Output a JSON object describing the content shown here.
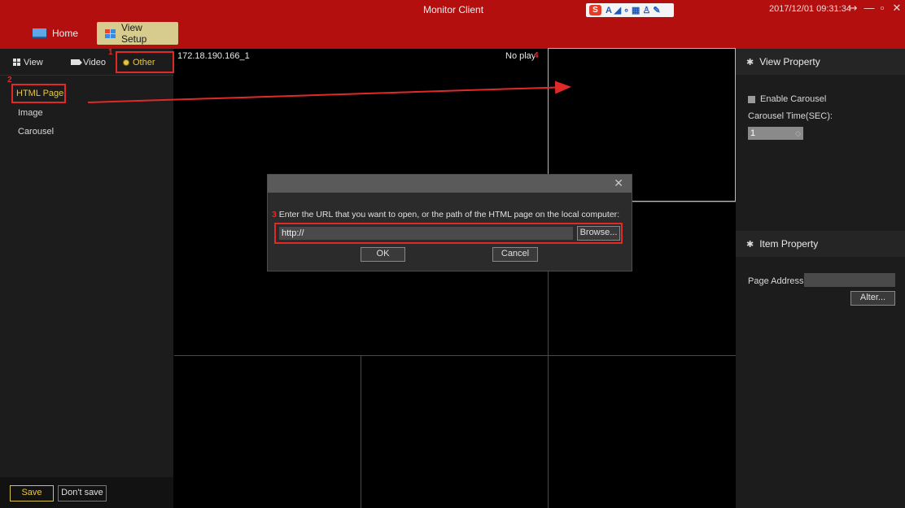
{
  "titlebar": {
    "app_title": "Monitor Client",
    "datetime": "2017/12/01 09:31:34",
    "ime_text": "A ◢ ∘ ▦ ♙ ✎",
    "window_controls": [
      "↪",
      "—",
      "▫",
      "✕"
    ]
  },
  "top_tabs": {
    "home": "Home",
    "view_setup": "View Setup"
  },
  "left_tabs": {
    "view": "View",
    "video": "Video",
    "other": "Other"
  },
  "left_items": {
    "html_page": "HTML Page",
    "image": "Image",
    "carousel": "Carousel"
  },
  "step_markers": [
    "1",
    "2",
    "3",
    "4"
  ],
  "left_buttons": {
    "save": "Save",
    "dont_save": "Don't save"
  },
  "video": {
    "channel_label": "172.18.190.166_1",
    "status": "No play"
  },
  "dialog": {
    "close": "✕",
    "prompt": "Enter the URL that you want to open, or the path of the HTML page on the local computer:",
    "url_value": "http://",
    "browse": "Browse...",
    "ok": "OK",
    "cancel": "Cancel"
  },
  "right_panel": {
    "view_property": "View Property",
    "enable_carousel": "Enable Carousel",
    "carousel_time_label": "Carousel Time(SEC):",
    "carousel_time_value": "1",
    "item_property": "Item Property",
    "page_address_label": "Page Address:",
    "page_address_value": "",
    "alter": "Alter..."
  },
  "colors": {
    "titlebar": "#b40f0f",
    "accent_yellow": "#e8c640",
    "annotation_red": "#e02a2a",
    "panel_bg": "#1c1c1c"
  }
}
